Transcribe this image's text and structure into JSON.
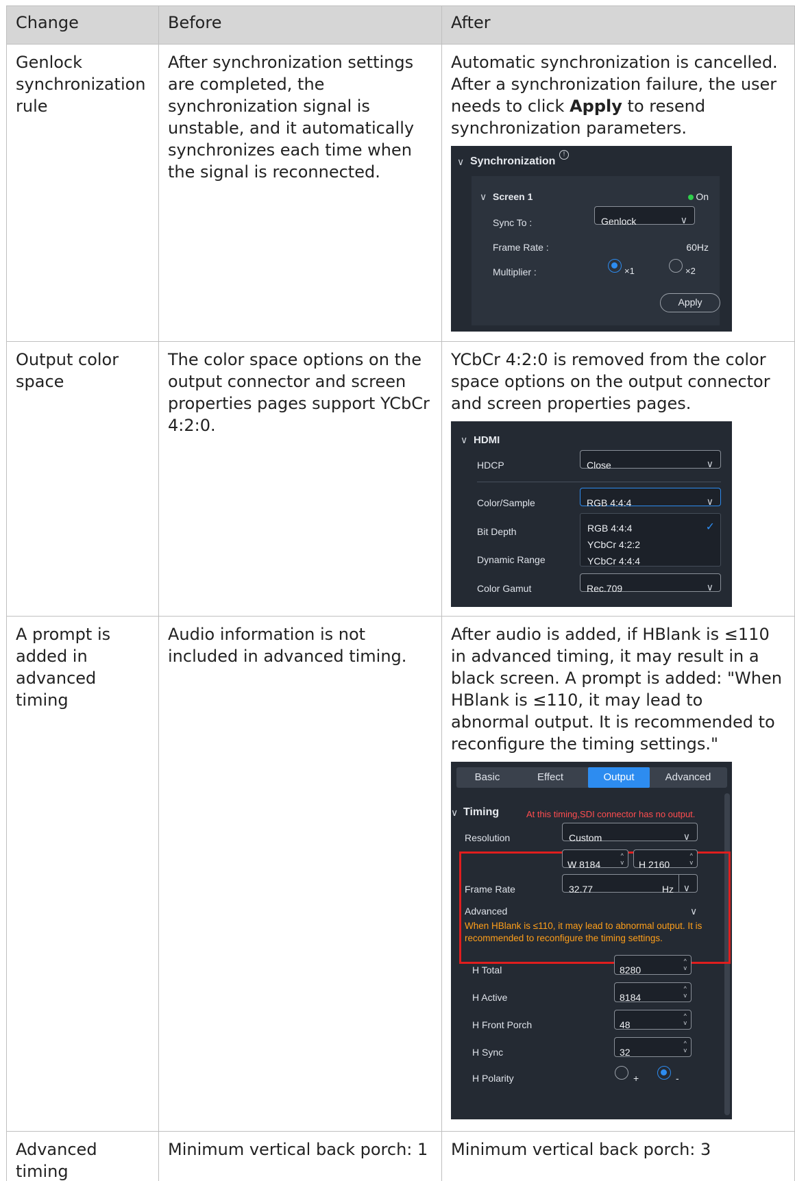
{
  "headers": [
    "Change",
    "Before",
    "After"
  ],
  "rows": [
    {
      "change": "Genlock synchronization rule",
      "before": "After synchronization settings are completed, the synchronization signal is unstable, and it automatically synchronizes each time when the signal is reconnected.",
      "after_pre": "Automatic synchronization is cancelled. After a synchronization failure, the user needs to click ",
      "after_bold": "Apply",
      "after_post": " to resend synchronization parameters."
    },
    {
      "change": "Output color space",
      "before": "The color space options on the output connector and screen properties pages support YCbCr 4:2:0.",
      "after": "YCbCr 4:2:0 is removed from the color space options on the output connector and screen properties pages."
    },
    {
      "change": "A prompt is added in advanced timing",
      "before": "Audio information is not included in advanced timing.",
      "after": "After audio is added, if HBlank is ≤110 in advanced timing, it may result in a black screen. A prompt is added: \"When HBlank is ≤110, it may lead to abnormal output. It is recommended to reconfigure the timing settings.\""
    },
    {
      "change": "Advanced timing",
      "before": "Minimum vertical back porch: 1",
      "after": "Minimum vertical back porch: 3"
    }
  ],
  "sync_panel": {
    "title": "Synchronization",
    "screen": "Screen 1",
    "status": "On",
    "sync_to_label": "Sync To :",
    "sync_to_value": "Genlock",
    "frame_rate_label": "Frame Rate :",
    "frame_rate_value": "60Hz",
    "multiplier_label": "Multiplier :",
    "mult_x1": "×1",
    "mult_x2": "×2",
    "multiplier_selected": "×1",
    "apply": "Apply",
    "colors": {
      "bg": "#242a33",
      "accent": "#2d8cf0",
      "status_on": "#2fcf4b"
    }
  },
  "hdmi_panel": {
    "title": "HDMI",
    "hdcp_label": "HDCP",
    "hdcp_value": "Close",
    "color_sample_label": "Color/Sample",
    "color_sample_value": "RGB 4:4:4",
    "options": [
      "RGB 4:4:4",
      "YCbCr 4:2:2",
      "YCbCr 4:4:4"
    ],
    "bit_depth_label": "Bit Depth",
    "dynamic_range_label": "Dynamic Range",
    "color_gamut_label": "Color Gamut",
    "color_gamut_value": "Rec.709"
  },
  "timing_panel": {
    "tabs": [
      "Basic",
      "Effect",
      "Output",
      "Advanced"
    ],
    "active_tab": "Output",
    "section": "Timing",
    "sdi_warning": "At this timing,SDI connector has no output.",
    "resolution_label": "Resolution",
    "resolution_value": "Custom",
    "width": "W 8184",
    "height": "H 2160",
    "frame_rate_label": "Frame Rate",
    "frame_rate_value": "32.77",
    "frame_rate_unit": "Hz",
    "advanced_label": "Advanced",
    "prompt": "When HBlank is ≤110, it may lead to abnormal output. It is recommended to reconfigure the timing settings.",
    "fields": [
      {
        "label": "H Total",
        "value": "8280"
      },
      {
        "label": "H Active",
        "value": "8184"
      },
      {
        "label": "H Front Porch",
        "value": "48"
      },
      {
        "label": "H Sync",
        "value": "32"
      }
    ],
    "polarity_label": "H Polarity",
    "polarity_plus": "+",
    "polarity_minus": "-",
    "polarity_selected": "-",
    "colors": {
      "warning_red": "#ff4d4f",
      "warning_orange": "#ff9f1a",
      "highlight_box": "#e01e1e"
    }
  }
}
